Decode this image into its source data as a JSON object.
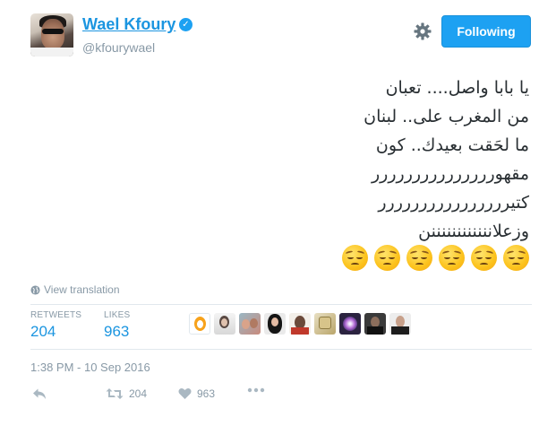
{
  "user": {
    "display_name": "Wael Kfoury",
    "handle": "@kfourywael",
    "verified": true
  },
  "follow_button": {
    "label": "Following"
  },
  "tweet": {
    "lines": [
      "يا بابا واصل.... تعبان",
      "من المغرب على.. لبنان",
      "ما لحَقت بعيدك.. كون",
      "مقهوررررررررررررررر",
      "كتيرررررررررررررررر",
      "وزعلاننننننننننننن"
    ],
    "emoji_count": 6,
    "emoji_name": "pensive-face"
  },
  "view_translation": "View translation",
  "stats": {
    "retweets_label": "RETWEETS",
    "retweets": "204",
    "likes_label": "LIKES",
    "likes": "963"
  },
  "timestamp": "1:38 PM - 10 Sep 2016",
  "actions": {
    "reply_icon": "reply-icon",
    "retweet_icon": "retweet-icon",
    "retweet_count": "204",
    "like_icon": "heart-icon",
    "like_count": "963",
    "more_icon": "more-icon"
  },
  "colors": {
    "accent": "#1da1f2",
    "link": "#1b95e0",
    "muted": "#8899a6",
    "divider": "#e1e8ed"
  }
}
